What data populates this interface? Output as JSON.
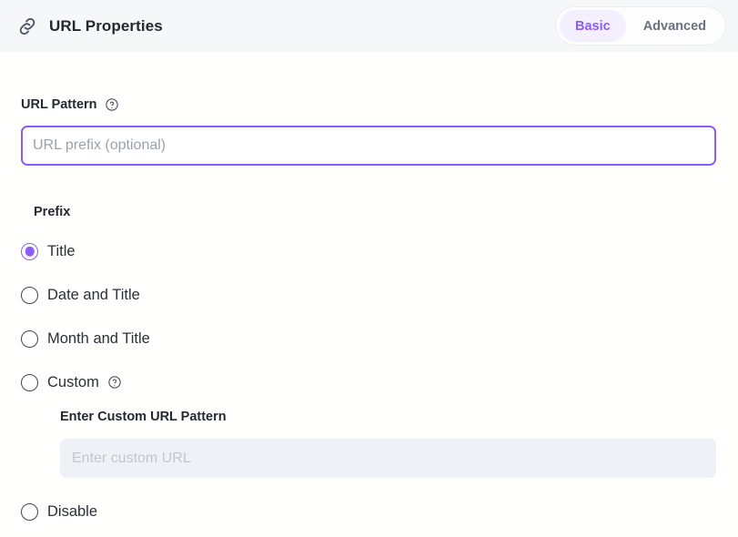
{
  "header": {
    "icon": "link-icon",
    "title": "URL Properties",
    "tabs": [
      {
        "label": "Basic",
        "active": true
      },
      {
        "label": "Advanced",
        "active": false
      }
    ]
  },
  "main": {
    "url_pattern": {
      "label": "URL Pattern",
      "help_icon": "help-circle-icon",
      "input_value": "",
      "input_placeholder": "URL prefix (optional)",
      "focused": true
    },
    "prefix": {
      "label": "Prefix",
      "selected": "Title",
      "options": [
        {
          "label": "Title",
          "checked": true
        },
        {
          "label": "Date and Title",
          "checked": false
        },
        {
          "label": "Month and Title",
          "checked": false
        },
        {
          "label": "Custom",
          "checked": false,
          "help_icon": "help-circle-icon"
        },
        {
          "label": "Disable",
          "checked": false
        }
      ]
    },
    "custom_url": {
      "label": "Enter Custom URL Pattern",
      "input_value": "",
      "input_placeholder": "Enter custom URL",
      "disabled": true
    }
  },
  "colors": {
    "accent": "#8b5cf6",
    "accent_soft": "#f4effe",
    "header_bg": "#f6f7f9",
    "body_bg": "#fffffd",
    "text": "#2b2f38",
    "muted": "#6b7280",
    "disabled_bg": "#eef1f5",
    "disabled_text": "#c3c8d0"
  }
}
